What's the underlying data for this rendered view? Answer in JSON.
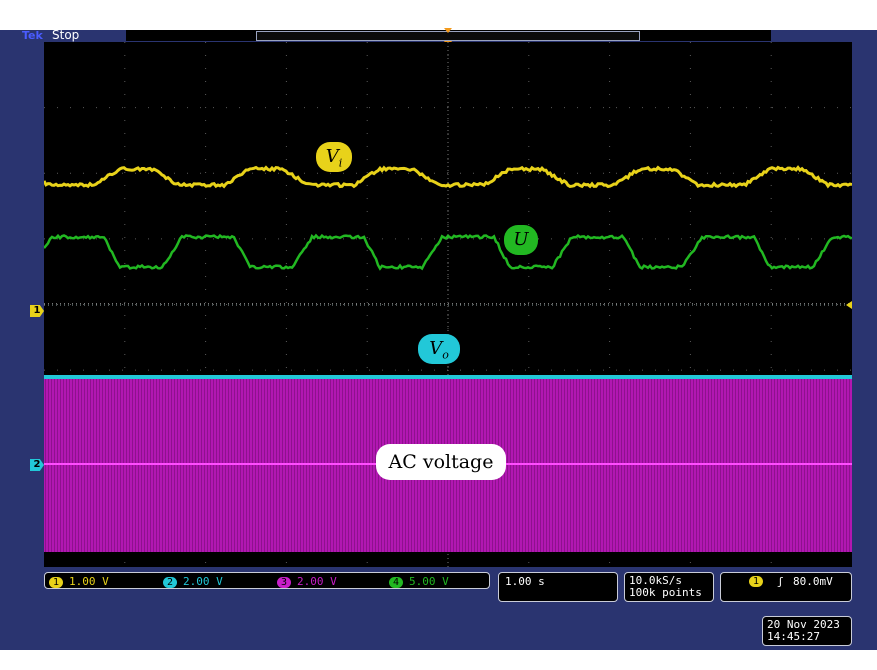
{
  "header": {
    "brand": "Tek",
    "status": "Stop"
  },
  "channels": {
    "ch1": {
      "number": "1",
      "scale": "1.00 V",
      "color": "#e8d21a"
    },
    "ch2": {
      "number": "2",
      "scale": "2.00 V",
      "color": "#22c8d8"
    },
    "ch3": {
      "number": "3",
      "scale": "2.00 V",
      "color": "#c81ec8"
    },
    "ch4": {
      "number": "4",
      "scale": "5.00 V",
      "color": "#22b822"
    }
  },
  "timebase": "1.00 s",
  "sample_rate": "10.0kS/s",
  "record_length": "100k points",
  "trigger": {
    "source": "1",
    "slope": "ʃ",
    "level": "80.0mV"
  },
  "datetime": {
    "date": "20 Nov 2023",
    "time": "14:45:27"
  },
  "annotations": {
    "vi": "V",
    "vi_sub": "i",
    "u": "U",
    "vo": "V",
    "vo_sub": "o",
    "ac": "AC voltage"
  },
  "markers": {
    "ch1": "1",
    "ch2": "2"
  }
}
